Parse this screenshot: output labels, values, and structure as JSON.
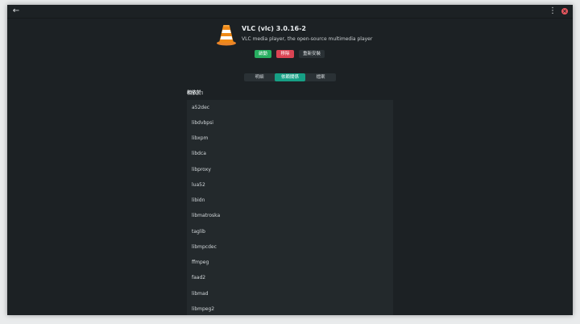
{
  "header": {
    "back_icon": "arrow-left-icon",
    "menu_icon": "kebab-menu-icon",
    "close_icon": "close-icon",
    "back_glyph": "←",
    "menu_glyph": "⋮",
    "close_glyph": "×"
  },
  "app": {
    "icon": "vlc-traffic-cone-icon",
    "title": "VLC (vlc)  3.0.16-2",
    "summary": "VLC media player, the open-source multimedia player"
  },
  "actions": {
    "launch": "啟動",
    "remove": "移除",
    "reinstall": "重新安裝"
  },
  "tabs": {
    "details": "明細",
    "dependencies": "依賴關係",
    "files": "檔案"
  },
  "dependencies": {
    "label": "相依於:",
    "items": [
      "a52dec",
      "libdvbpsi",
      "libxpm",
      "libdca",
      "libproxy",
      "lua52",
      "libidn",
      "libmatroska",
      "taglib",
      "libmpcdec",
      "ffmpeg",
      "faad2",
      "libmad",
      "libmpeg2"
    ]
  },
  "colors": {
    "background": "#1c2124",
    "launch": "#27ae60",
    "remove": "#da4453",
    "tab_active": "#16a085",
    "cone_orange": "#f08a17"
  }
}
